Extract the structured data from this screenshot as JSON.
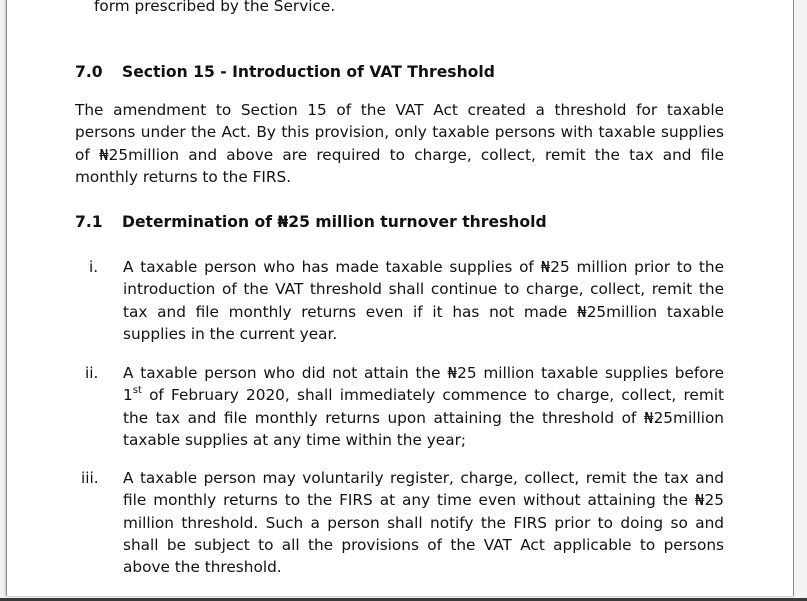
{
  "top_fragment": "form prescribed by the Service.",
  "section_7_0": {
    "number": "7.0",
    "title": "Section 15 - Introduction of VAT Threshold",
    "paragraph": "The amendment to Section 15 of the VAT Act created a threshold for taxable persons under the Act. By this provision, only taxable persons with taxable supplies of ₦25million and above are required to charge, collect, remit the tax and file monthly returns to the FIRS."
  },
  "section_7_1": {
    "number": "7.1",
    "title": "Determination of ₦25 million turnover threshold",
    "items": [
      {
        "marker": "i.",
        "text": "A taxable person who has made taxable supplies of ₦25 million prior to the introduction of the VAT threshold shall continue to charge, collect, remit the tax and file monthly returns even if it has not made ₦25million taxable supplies in the current year."
      },
      {
        "marker": "ii.",
        "text_before_sup": "A taxable person who did not attain the ₦25 million taxable supplies before 1",
        "sup": "st",
        "text_after_sup": " of February 2020, shall immediately commence to charge, collect, remit the tax and file monthly returns upon attaining the threshold of ₦25million taxable supplies at any time within the year;"
      },
      {
        "marker": "iii.",
        "text": "A taxable person may voluntarily register, charge, collect, remit the tax and file monthly returns to the FIRS at any time even without attaining the ₦25 million threshold. Such a person shall notify the FIRS prior to doing so and shall be subject to all the provisions of the VAT Act applicable to persons above the threshold."
      }
    ]
  }
}
